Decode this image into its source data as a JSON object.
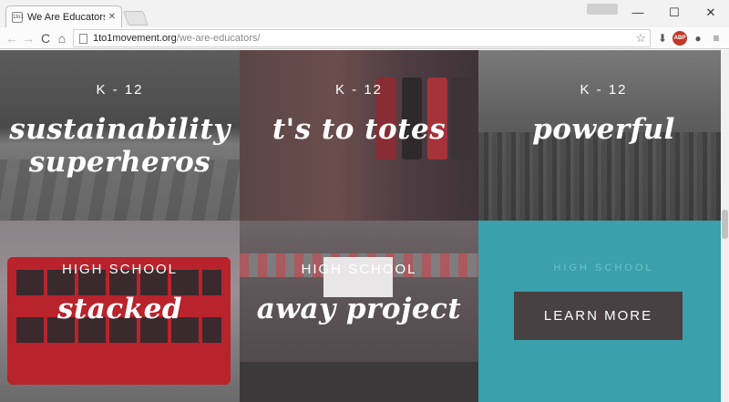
{
  "browser": {
    "tab_title": "We Are Educators ···",
    "tab_close": "✕",
    "favicon_text": "1to1",
    "url_host": "1to1movement.org",
    "url_path": "/we-are-educators/",
    "window_controls": {
      "minimize": "—",
      "maximize": "☐",
      "close": "✕"
    },
    "nav": {
      "back": "←",
      "forward": "→",
      "reload": "C",
      "home": "⌂"
    },
    "icons": {
      "star": "☆",
      "download": "⬇",
      "adblock": "ABP",
      "extension": "●",
      "menu": "≡"
    }
  },
  "tiles": [
    {
      "level": "K - 12",
      "title_line1": "sustainability",
      "title_line2": "superheros"
    },
    {
      "level": "K - 12",
      "title_line1": "t's to totes",
      "title_line2": ""
    },
    {
      "level": "K - 12",
      "title_line1": "powerful",
      "title_line2": ""
    },
    {
      "level": "HIGH SCHOOL",
      "title_line1": "stacked",
      "title_line2": ""
    },
    {
      "level": "HIGH SCHOOL",
      "title_line1": "away project",
      "title_line2": ""
    }
  ],
  "cta": {
    "subtitle": "HIGH SCHOOL",
    "button_label": "LEARN MORE"
  },
  "colors": {
    "cta_background": "#3aa0ab",
    "cta_button": "#494043"
  }
}
